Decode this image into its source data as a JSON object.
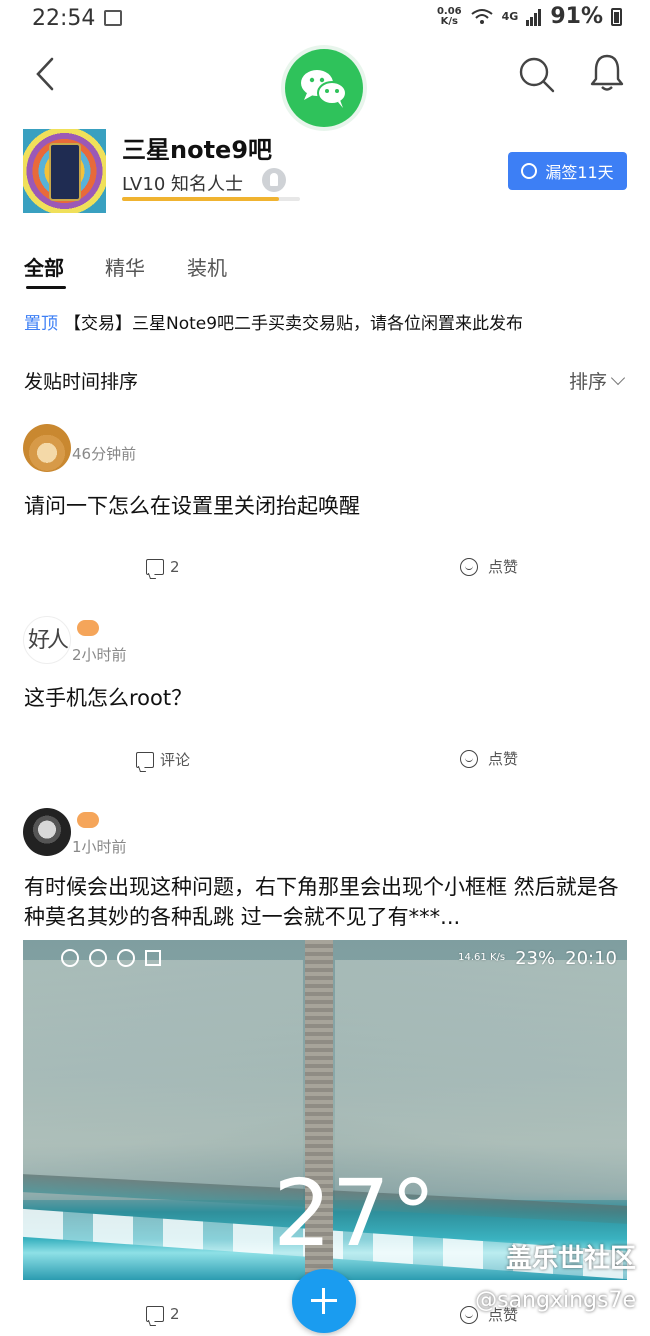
{
  "status_bar": {
    "time": "22:54",
    "net_speed_value": "0.06",
    "net_speed_unit": "K/s",
    "network": "4G",
    "battery": "91%"
  },
  "forum": {
    "name": "三星note9吧",
    "level": "LV10",
    "title": "知名人士",
    "level_progress": 0.88,
    "sign_button": "漏签11天"
  },
  "tabs": [
    "全部",
    "精华",
    "装机"
  ],
  "pinned": {
    "tag": "置顶",
    "text": "【交易】三星Note9吧二手买卖交易贴，请各位闲置来此发布"
  },
  "sort": {
    "label": "发贴时间排序",
    "button": "排序"
  },
  "posts": [
    {
      "time": "46分钟前",
      "title": "请问一下怎么在设置里关闭抬起唤醒",
      "comment": "2",
      "like": "点赞"
    },
    {
      "avatar_text": "好人",
      "time": "2小时前",
      "title": "这手机怎么root？",
      "comment": "评论",
      "like": "点赞"
    },
    {
      "time": "1小时前",
      "title": "有时候会出现这种问题，右下角那里会出现个小框框 然后就是各种莫名其妙的各种乱跳 过一会就不见了有***...",
      "comment": "2",
      "like": "点赞",
      "image": {
        "status_speed": "14.61 K/s",
        "status_battery": "23%",
        "status_time": "20:10",
        "temperature": "27°"
      }
    }
  ],
  "watermark": {
    "site": "盖乐世社区",
    "handle": "@sangxings7e"
  },
  "colors": {
    "accent": "#3d7ff5",
    "wechat_green": "#2fc25b",
    "fab": "#1a9cf0",
    "level_bar": "#f0b330"
  }
}
